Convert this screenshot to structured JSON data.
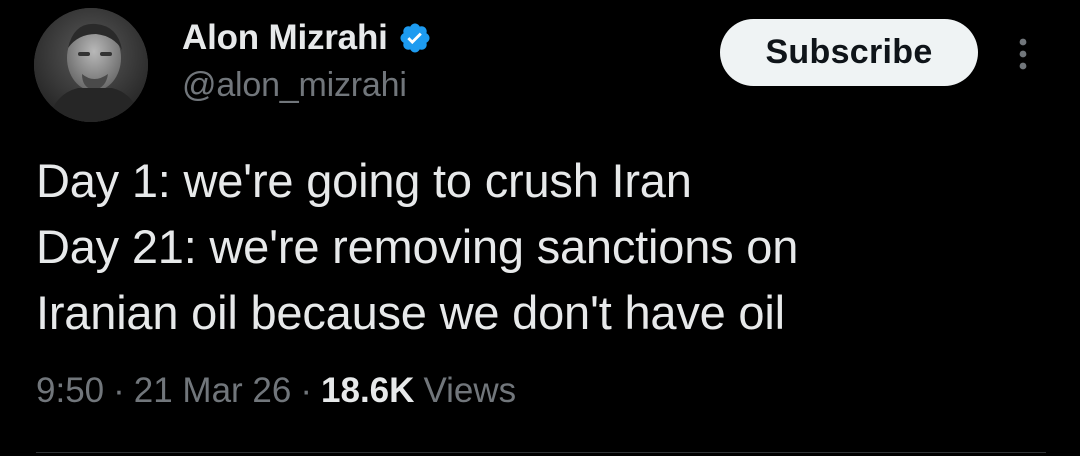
{
  "author": {
    "display_name": "Alon Mizrahi",
    "handle": "@alon_mizrahi",
    "verified": true,
    "verified_color": "#1d9bf0",
    "avatar_icon": "profile-photo"
  },
  "actions": {
    "subscribe_label": "Subscribe",
    "more_icon": "more-vertical-icon"
  },
  "tweet": {
    "lines": [
      "Day 1: we're going to crush Iran",
      "Day 21: we're removing sanctions on",
      "Iranian oil because we don't have oil"
    ]
  },
  "meta": {
    "time": "9:50",
    "date": "21 Mar 26",
    "separator": "·",
    "views_count": "18.6K",
    "views_label": "Views"
  },
  "colors": {
    "background": "#000000",
    "text_primary": "#e7e9ea",
    "text_secondary": "#71767b",
    "button_bg": "#eff3f4",
    "button_text": "#0f1419"
  }
}
